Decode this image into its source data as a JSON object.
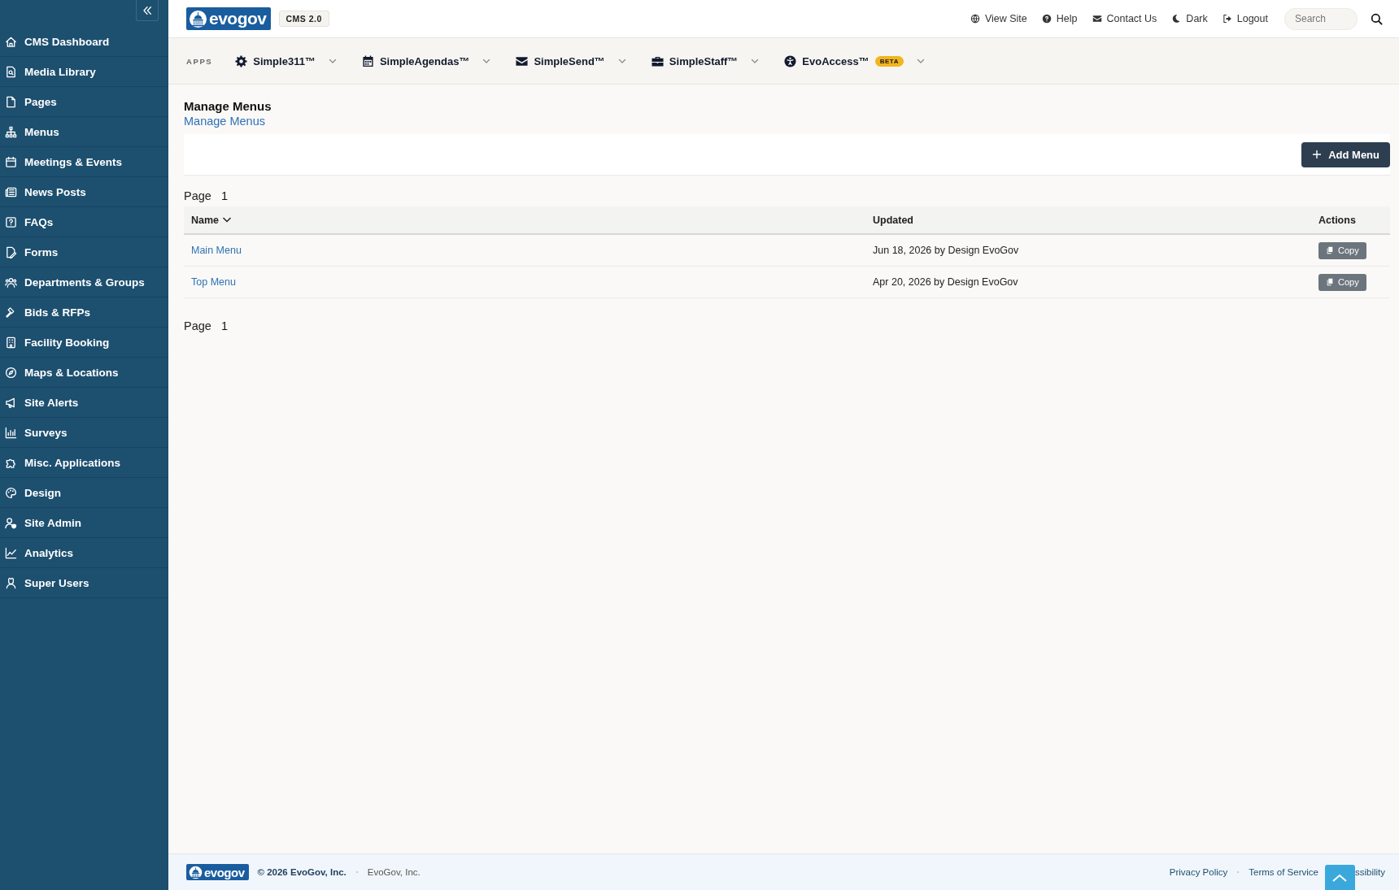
{
  "sidebar": {
    "items": [
      {
        "label": "CMS Dashboard"
      },
      {
        "label": "Media Library"
      },
      {
        "label": "Pages"
      },
      {
        "label": "Menus"
      },
      {
        "label": "Meetings & Events"
      },
      {
        "label": "News Posts"
      },
      {
        "label": "FAQs"
      },
      {
        "label": "Forms"
      },
      {
        "label": "Departments & Groups"
      },
      {
        "label": "Bids & RFPs"
      },
      {
        "label": "Facility Booking"
      },
      {
        "label": "Maps & Locations"
      },
      {
        "label": "Site Alerts"
      },
      {
        "label": "Surveys"
      },
      {
        "label": "Misc. Applications"
      },
      {
        "label": "Design"
      },
      {
        "label": "Site Admin"
      },
      {
        "label": "Analytics"
      },
      {
        "label": "Super Users"
      }
    ]
  },
  "header": {
    "logo": "evogov",
    "badge": "CMS 2.0",
    "links": [
      {
        "label": "View Site"
      },
      {
        "label": "Help"
      },
      {
        "label": "Contact Us"
      },
      {
        "label": "Dark"
      },
      {
        "label": "Logout"
      }
    ],
    "search": {
      "placeholder": "Search"
    }
  },
  "apps": {
    "label": "APPS",
    "items": [
      {
        "label": "Simple311™"
      },
      {
        "label": "SimpleAgendas™"
      },
      {
        "label": "SimpleSend™"
      },
      {
        "label": "SimpleStaff™"
      },
      {
        "label": "EvoAccess™",
        "badge": "BETA"
      }
    ]
  },
  "page": {
    "title": "Manage Menus",
    "breadcrumb": "Manage Menus",
    "add_button": "Add Menu",
    "pager_top": {
      "label": "Page",
      "number": "1"
    },
    "pager_bottom": {
      "label": "Page",
      "number": "1"
    }
  },
  "table": {
    "columns": [
      {
        "label": "Name",
        "sorted": true
      },
      {
        "label": "Updated",
        "sorted": false
      },
      {
        "label": "Actions",
        "sorted": false
      }
    ],
    "rows": [
      {
        "name": "Main Menu",
        "updated": "Jun 18, 2026 by Design EvoGov",
        "action": "Copy"
      },
      {
        "name": "Top Menu",
        "updated": "Apr 20, 2026 by Design EvoGov",
        "action": "Copy"
      }
    ]
  },
  "footer": {
    "logo": "evogov",
    "copyright": "© 2026 EvoGov, Inc.",
    "company": "EvoGov, Inc.",
    "links": [
      {
        "label": "Privacy Policy"
      },
      {
        "label": "Terms of Service"
      },
      {
        "label": "ssibility"
      }
    ]
  }
}
